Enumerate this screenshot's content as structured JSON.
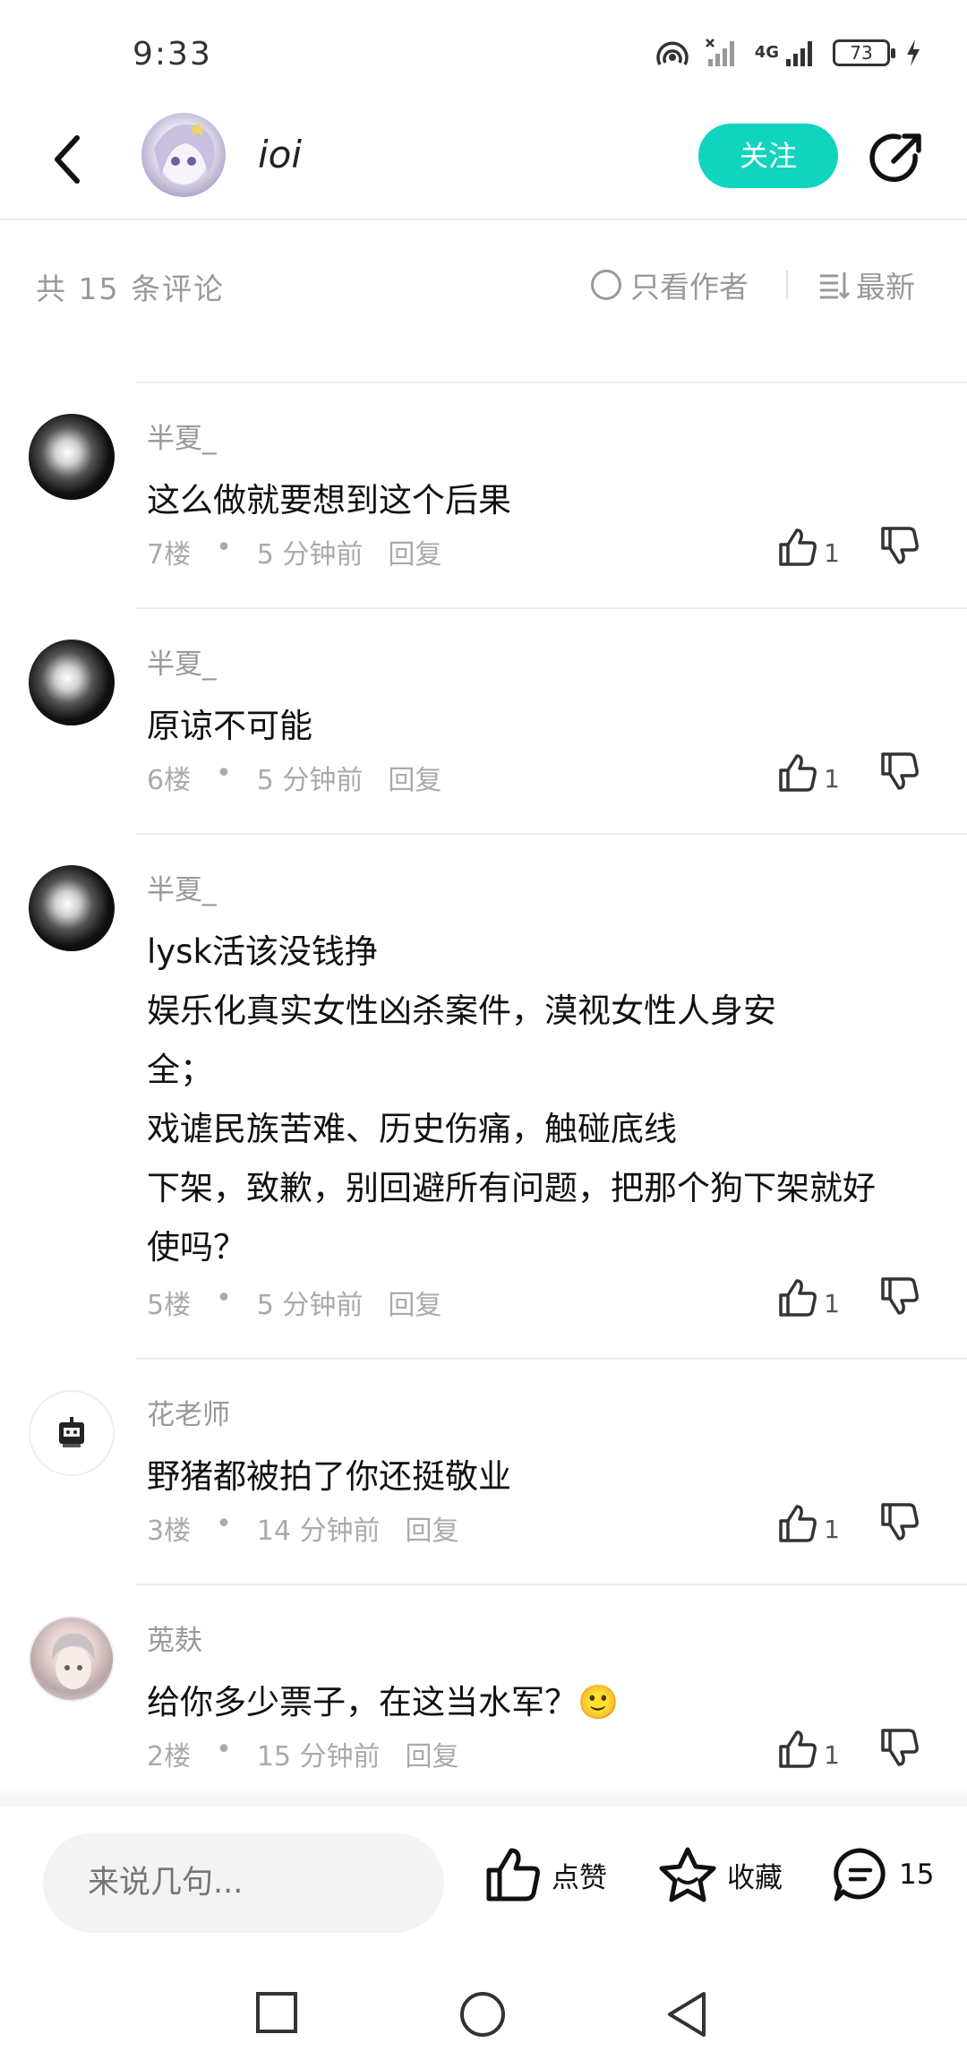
{
  "status_bar": {
    "time": "9:33",
    "network": "4G",
    "battery": "73"
  },
  "header": {
    "username": "ioi",
    "follow_label": "关注"
  },
  "comment_toolbar": {
    "count_text": "共 15 条评论",
    "author_only_label": "只看作者",
    "sort_label": "最新"
  },
  "comments": [
    {
      "avatar": "smoke-avatar",
      "name": "半夏_",
      "lines": [
        "这么做就要想到这个后果"
      ],
      "floor": "7楼",
      "time": "5 分钟前",
      "reply": "回复",
      "likes": "1"
    },
    {
      "avatar": "smoke-avatar",
      "name": "半夏_",
      "lines": [
        "原谅不可能"
      ],
      "floor": "6楼",
      "time": "5 分钟前",
      "reply": "回复",
      "likes": "1"
    },
    {
      "avatar": "smoke-avatar",
      "name": "半夏_",
      "lines": [
        "lysk活该没钱挣",
        "娱乐化真实女性凶杀案件，漠视女性人身安",
        "全；",
        "戏谑民族苦难、历史伤痛，触碰底线",
        "下架，致歉，别回避所有问题，把那个狗下架就好",
        "使吗？"
      ],
      "floor": "5楼",
      "time": "5 分钟前",
      "reply": "回复",
      "likes": "1"
    },
    {
      "avatar": "robot-avatar",
      "name": "花老师",
      "lines": [
        "野猪都被拍了你还挺敬业"
      ],
      "floor": "3楼",
      "time": "14 分钟前",
      "reply": "回复",
      "likes": "1"
    },
    {
      "avatar": "anime-avatar",
      "name": "莵麸",
      "lines": [
        "给你多少票子，在这当水军？🙂"
      ],
      "floor": "2楼",
      "time": "15 分钟前",
      "reply": "回复",
      "likes": "1"
    }
  ],
  "bottom_bar": {
    "input_placeholder": "来说几句...",
    "like_label": "点赞",
    "favorite_label": "收藏",
    "comment_count": "15"
  },
  "colors": {
    "accent": "#11d4bf",
    "meta_text": "#aaaaaa",
    "divider": "#ededed"
  }
}
